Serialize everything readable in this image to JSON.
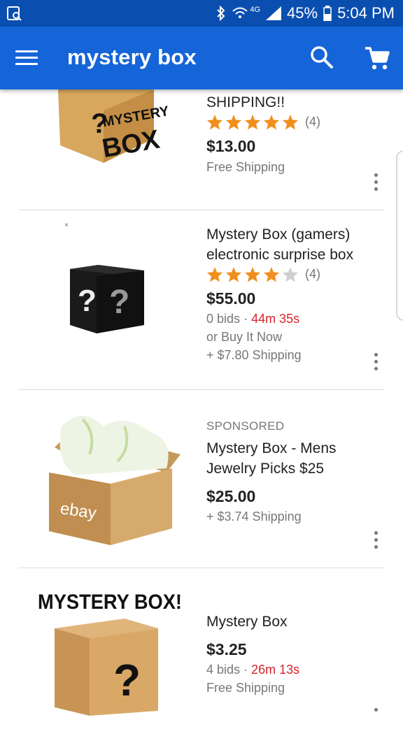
{
  "status_bar": {
    "network_label": "4G",
    "battery": "45%",
    "time": "5:04 PM"
  },
  "app_bar": {
    "title": "mystery box"
  },
  "listings": [
    {
      "title": "SHIPPING!!",
      "rating": 5,
      "review_count": "(4)",
      "price": "$13.00",
      "shipping": "Free Shipping",
      "image_text": [
        "MYSTERY",
        "BOX"
      ]
    },
    {
      "title": "Mystery Box (gamers) electronic surprise box",
      "rating": 4,
      "review_count": "(4)",
      "price": "$55.00",
      "bids": "0 bids",
      "time_left": "44m 35s",
      "buy_it_now": "or Buy It Now",
      "shipping": "+ $7.80 Shipping"
    },
    {
      "sponsored_label": "SPONSORED",
      "title": "Mystery Box - Mens Jewelry Picks $25",
      "price": "$25.00",
      "shipping": "+ $3.74 Shipping",
      "image_text": "ebay"
    },
    {
      "title": "Mystery Box",
      "price": "$3.25",
      "bids": "4 bids",
      "time_left": "26m 13s",
      "shipping": "Free Shipping",
      "image_text": "MYSTERY BOX!"
    }
  ],
  "colors": {
    "status_bar": "#0a4fb0",
    "app_bar": "#1565d8",
    "star": "#f18f1c",
    "time_left": "#d8232a"
  }
}
